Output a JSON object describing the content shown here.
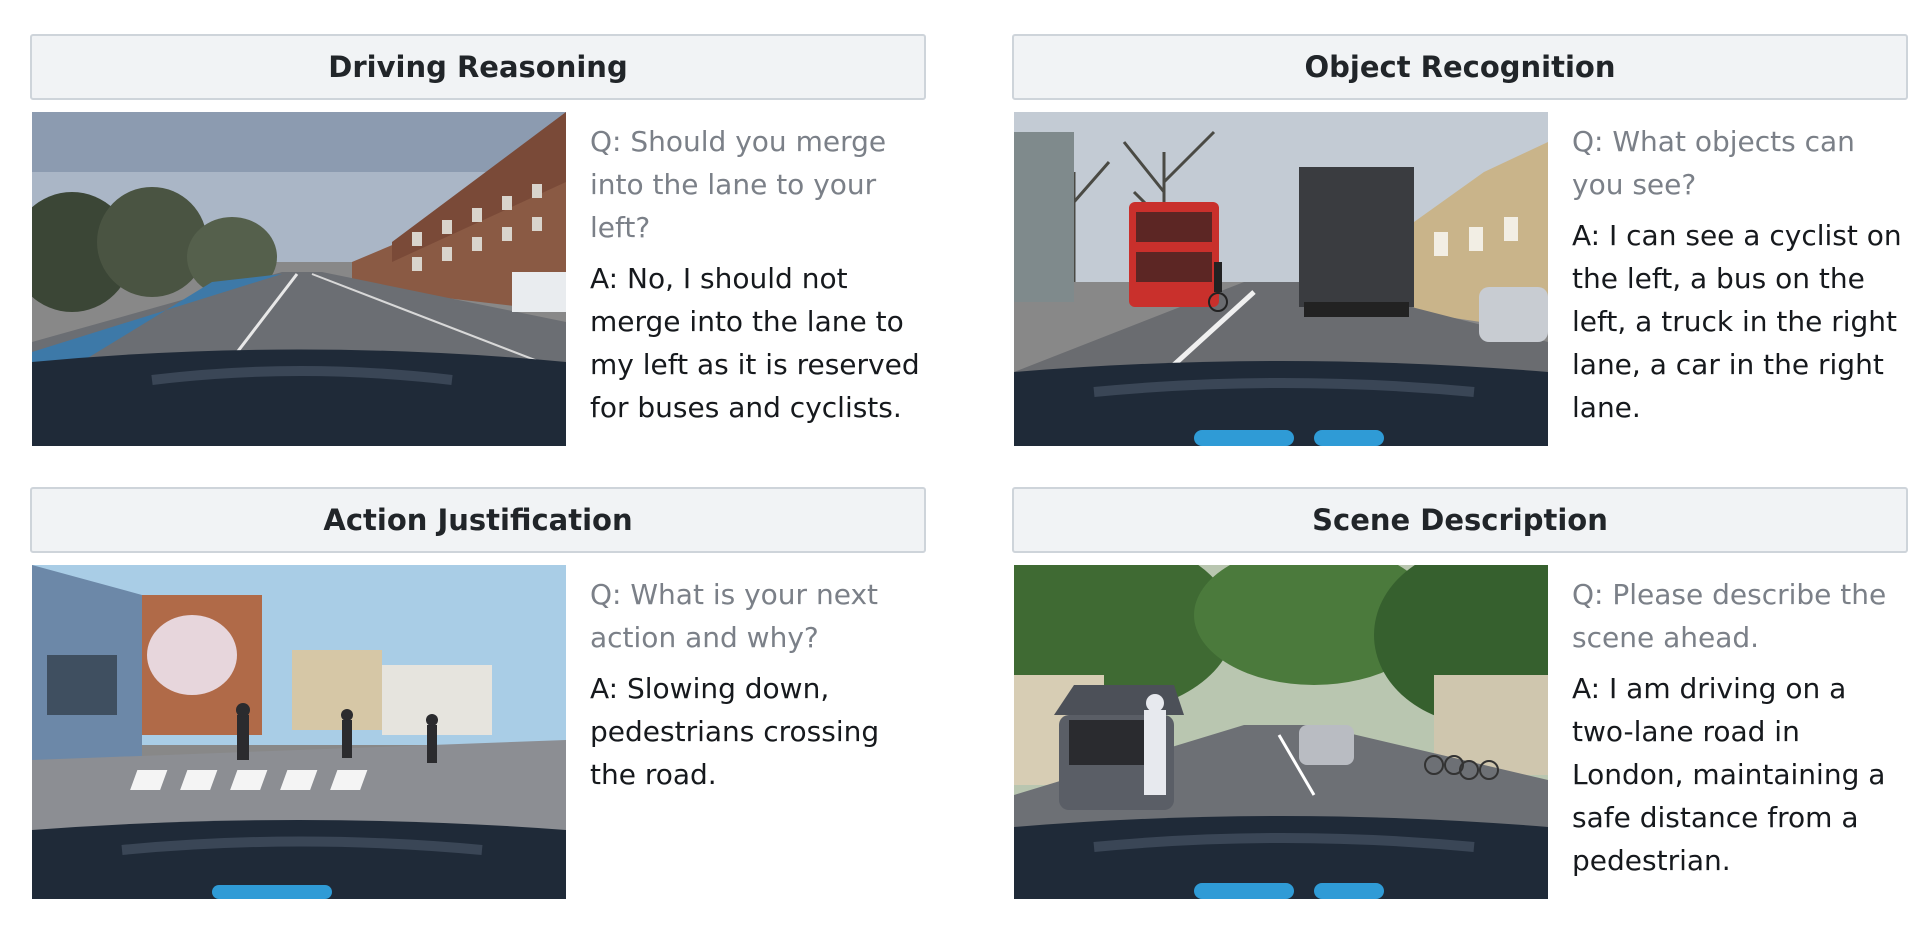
{
  "panels": [
    {
      "title": "Driving Reasoning",
      "question": "Q: Should you merge into the lane to your left?",
      "answer": "A: No, I should not merge into the lane to my left as it is reserved for buses and cyclists.",
      "scene_icon": "dashcam-street-brick-buildings"
    },
    {
      "title": "Object Recognition",
      "question": "Q: What objects can you see?",
      "answer": "A: I can see a cyclist on the left, a bus on the left, a truck in the right lane, a car in the right lane.",
      "scene_icon": "dashcam-street-bus-truck"
    },
    {
      "title": "Action Justification",
      "question": "Q: What is your next action and why?",
      "answer": "A: Slowing down, pedestrians crossing the road.",
      "scene_icon": "dashcam-crosswalk-pedestrians"
    },
    {
      "title": "Scene Description",
      "question": "Q: Please describe the scene ahead.",
      "answer": "A: I am driving on a two-lane road in London, maintaining a safe distance from a pedestrian.",
      "scene_icon": "dashcam-tree-lined-road"
    }
  ],
  "colors": {
    "header_bg": "#f1f3f5",
    "header_border": "#ced4da",
    "question": "#7b8088",
    "answer": "#16191d",
    "car_hood": "#1f2a38",
    "bus_red": "#c9302c"
  }
}
